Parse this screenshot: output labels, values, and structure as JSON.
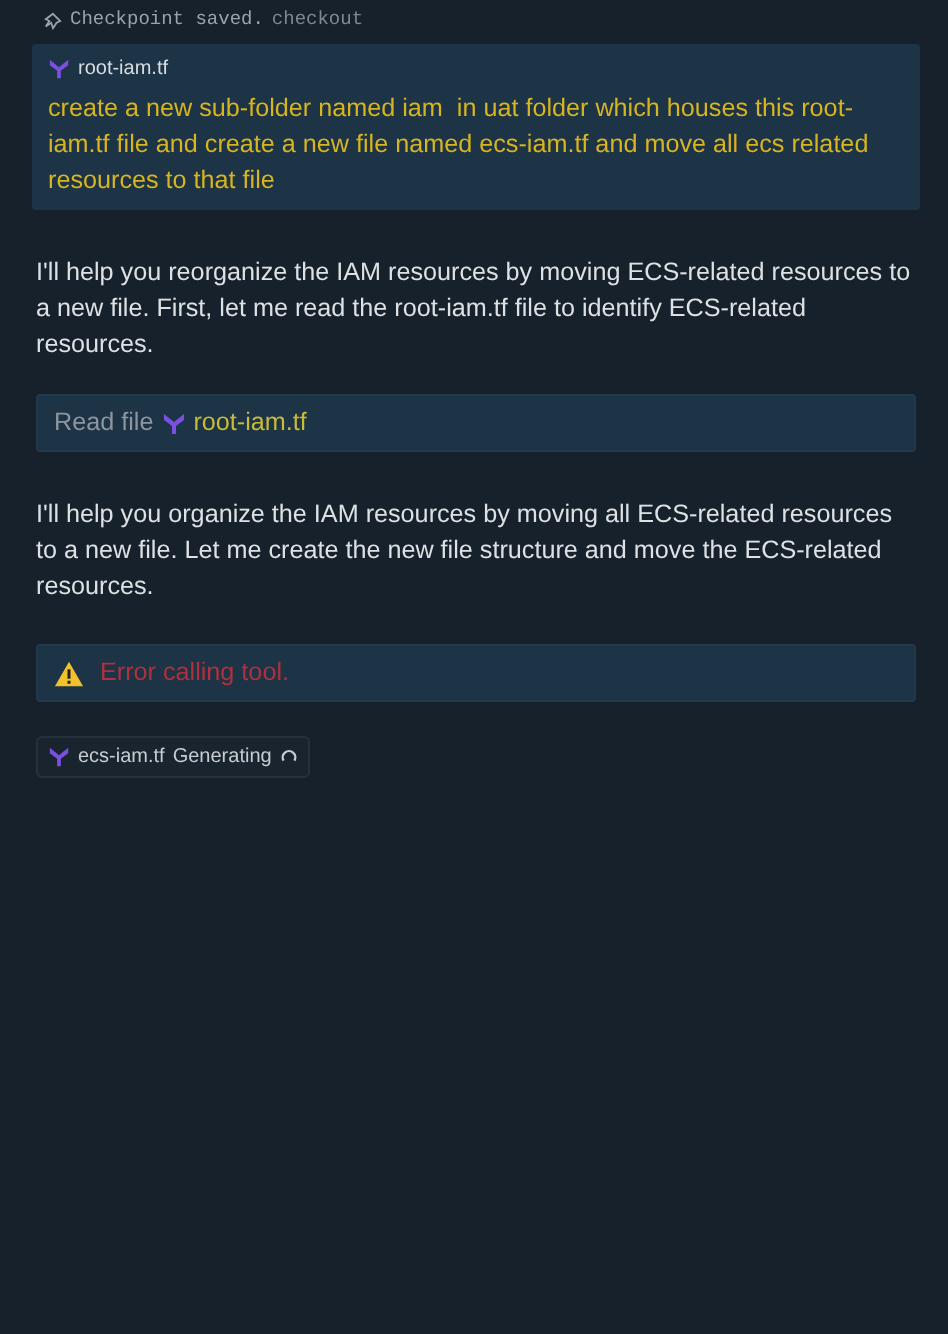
{
  "checkpoint": {
    "label": "Checkpoint saved.",
    "action": "checkout"
  },
  "user_message": {
    "file": "root-iam.tf",
    "text": "create a new sub-folder named iam  in uat folder which houses this root-iam.tf file and create a new file named ecs-iam.tf and move all ecs related resources to that file"
  },
  "items": [
    {
      "kind": "paragraph",
      "text": "I'll help you reorganize the IAM resources by moving ECS-related resources to a new file. First, let me read the root-iam.tf file to identify ECS-related resources."
    },
    {
      "kind": "tool",
      "label": "Read file",
      "file": "root-iam.tf"
    },
    {
      "kind": "paragraph",
      "text": "I'll help you organize the IAM resources by moving all ECS-related resources to a new file. Let me create the new file structure and move the ECS-related resources."
    },
    {
      "kind": "error",
      "text": "Error calling tool."
    },
    {
      "kind": "chip",
      "file": "ecs-iam.tf",
      "status": "Generating"
    }
  ]
}
